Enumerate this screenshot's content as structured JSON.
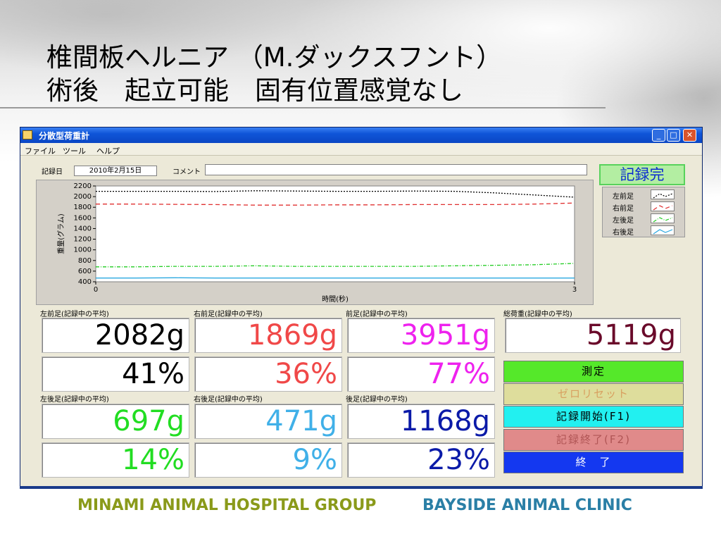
{
  "slide": {
    "title_line1": "椎間板ヘルニア （M.ダックスフント）",
    "title_line2": "術後　起立可能　固有位置感覚なし"
  },
  "window": {
    "title": "分散型荷重計",
    "menu": [
      "ファイル",
      "ツール",
      "ヘルプ"
    ],
    "record_date_label": "記録日",
    "record_date": "2010年2月15日",
    "comment_label": "コメント",
    "comment_value": "",
    "status": "記録完"
  },
  "chart_data": {
    "type": "line",
    "xlabel": "時間(秒)",
    "ylabel": "重量(グラム)",
    "xlim": [
      0,
      3
    ],
    "ylim": [
      400,
      2200
    ],
    "x_ticks": [
      "0",
      "3"
    ],
    "y_ticks": [
      "2200",
      "2000",
      "1800",
      "1600",
      "1400",
      "1200",
      "1000",
      "800",
      "600",
      "400"
    ],
    "x": [
      0,
      0.25,
      0.5,
      0.75,
      1.0,
      1.25,
      1.5,
      1.75,
      2.0,
      2.25,
      2.5,
      2.75,
      3.0
    ],
    "series": [
      {
        "name": "左前足",
        "color": "#000000",
        "dash": "2,2",
        "values": [
          2100,
          2100,
          2100,
          2095,
          2110,
          2105,
          2100,
          2100,
          2105,
          2100,
          2070,
          2030,
          1990
        ]
      },
      {
        "name": "右前足",
        "color": "#e03030",
        "dash": "6,4",
        "values": [
          1860,
          1860,
          1855,
          1850,
          1840,
          1840,
          1845,
          1845,
          1850,
          1850,
          1850,
          1860,
          1880
        ]
      },
      {
        "name": "左後足",
        "color": "#22cc22",
        "dash": "5,2,1,2",
        "values": [
          680,
          680,
          690,
          690,
          700,
          690,
          690,
          690,
          690,
          700,
          710,
          720,
          745
        ]
      },
      {
        "name": "右後足",
        "color": "#2aa8e0",
        "dash": "",
        "values": [
          470,
          470,
          475,
          470,
          470,
          470,
          470,
          470,
          470,
          470,
          470,
          470,
          470
        ]
      }
    ],
    "legend_position": "right"
  },
  "readouts": {
    "lf_label": "左前足(記録中の平均)",
    "rf_label": "右前足(記録中の平均)",
    "front_label": "前足(記録中の平均)",
    "total_label": "総荷重(記録中の平均)",
    "lh_label": "左後足(記録中の平均)",
    "rh_label": "右後足(記録中の平均)",
    "hind_label": "後足(記録中の平均)",
    "lf_g": "2082g",
    "lf_pct": "41%",
    "rf_g": "1869g",
    "rf_pct": "36%",
    "front_g": "3951g",
    "front_pct": "77%",
    "total_g": "5119g",
    "lh_g": "697g",
    "lh_pct": "14%",
    "rh_g": "471g",
    "rh_pct": "9%",
    "hind_g": "1168g",
    "hind_pct": "23%",
    "colors": {
      "lf": "#000000",
      "rf": "#f04848",
      "front": "#ee22ee",
      "total": "#6a0a2a",
      "lh": "#22dd22",
      "rh": "#40b0e8",
      "hind": "#0a1aa8"
    }
  },
  "buttons": {
    "measure": "測定",
    "zero_reset": "ゼロリセット",
    "record_start": "記録開始(F1)",
    "record_end": "記録終了(F2)",
    "exit": "終　了"
  },
  "footer": {
    "group": "MINAMI ANIMAL HOSPITAL GROUP",
    "clinic": "BAYSIDE ANIMAL CLINIC"
  }
}
